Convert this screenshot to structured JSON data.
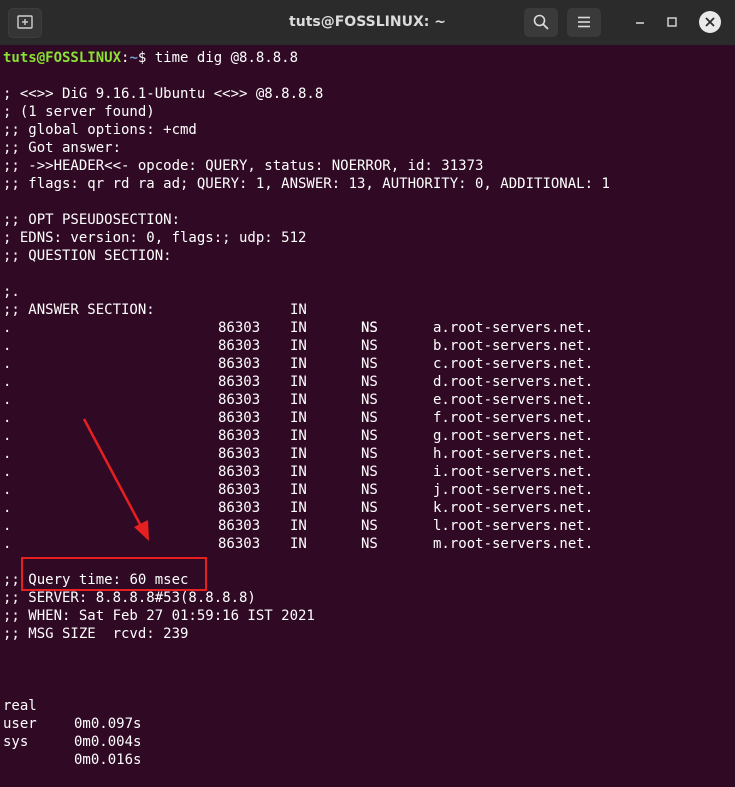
{
  "window": {
    "title": "tuts@FOSSLINUX: ~",
    "icons": [
      "new-tab-icon",
      "search-icon",
      "hamburger-menu-icon",
      "minimize-icon",
      "maximize-icon",
      "close-icon"
    ]
  },
  "prompt": {
    "user": "tuts@FOSSLINUX",
    "sep": ":",
    "path": "~",
    "dollar": "$ ",
    "command": "time dig @8.8.8.8"
  },
  "header_lines": [
    "; <<>> DiG 9.16.1-Ubuntu <<>> @8.8.8.8",
    "; (1 server found)",
    ";; global options: +cmd",
    ";; Got answer:",
    ";; ->>HEADER<<- opcode: QUERY, status: NOERROR, id: 31373",
    ";; flags: qr rd ra ad; QUERY: 1, ANSWER: 13, AUTHORITY: 0, ADDITIONAL: 1"
  ],
  "opt_lines": [
    ";; OPT PSEUDOSECTION:",
    "; EDNS: version: 0, flags:; udp: 512",
    ";; QUESTION SECTION:"
  ],
  "question": {
    "name": ";.",
    "class": "IN",
    "type": "NS"
  },
  "answer_header": ";; ANSWER SECTION:",
  "answers": [
    {
      "name": ".",
      "ttl": "86303",
      "class": "IN",
      "type": "NS",
      "value": "a.root-servers.net."
    },
    {
      "name": ".",
      "ttl": "86303",
      "class": "IN",
      "type": "NS",
      "value": "b.root-servers.net."
    },
    {
      "name": ".",
      "ttl": "86303",
      "class": "IN",
      "type": "NS",
      "value": "c.root-servers.net."
    },
    {
      "name": ".",
      "ttl": "86303",
      "class": "IN",
      "type": "NS",
      "value": "d.root-servers.net."
    },
    {
      "name": ".",
      "ttl": "86303",
      "class": "IN",
      "type": "NS",
      "value": "e.root-servers.net."
    },
    {
      "name": ".",
      "ttl": "86303",
      "class": "IN",
      "type": "NS",
      "value": "f.root-servers.net."
    },
    {
      "name": ".",
      "ttl": "86303",
      "class": "IN",
      "type": "NS",
      "value": "g.root-servers.net."
    },
    {
      "name": ".",
      "ttl": "86303",
      "class": "IN",
      "type": "NS",
      "value": "h.root-servers.net."
    },
    {
      "name": ".",
      "ttl": "86303",
      "class": "IN",
      "type": "NS",
      "value": "i.root-servers.net."
    },
    {
      "name": ".",
      "ttl": "86303",
      "class": "IN",
      "type": "NS",
      "value": "j.root-servers.net."
    },
    {
      "name": ".",
      "ttl": "86303",
      "class": "IN",
      "type": "NS",
      "value": "k.root-servers.net."
    },
    {
      "name": ".",
      "ttl": "86303",
      "class": "IN",
      "type": "NS",
      "value": "l.root-servers.net."
    },
    {
      "name": ".",
      "ttl": "86303",
      "class": "IN",
      "type": "NS",
      "value": "m.root-servers.net."
    }
  ],
  "stats": {
    "query_prefix": ";; ",
    "query_time": "Query time: 60 msec",
    "server": ";; SERVER: 8.8.8.8#53(8.8.8.8)",
    "when": ";; WHEN: Sat Feb 27 01:59:16 IST 2021",
    "msg_size": ";; MSG SIZE  rcvd: 239"
  },
  "timing": [
    {
      "label": "real",
      "value": "0m0.097s"
    },
    {
      "label": "user",
      "value": "0m0.004s"
    },
    {
      "label": "sys",
      "value": "0m0.016s"
    }
  ],
  "annotation": {
    "color": "#e62020"
  }
}
